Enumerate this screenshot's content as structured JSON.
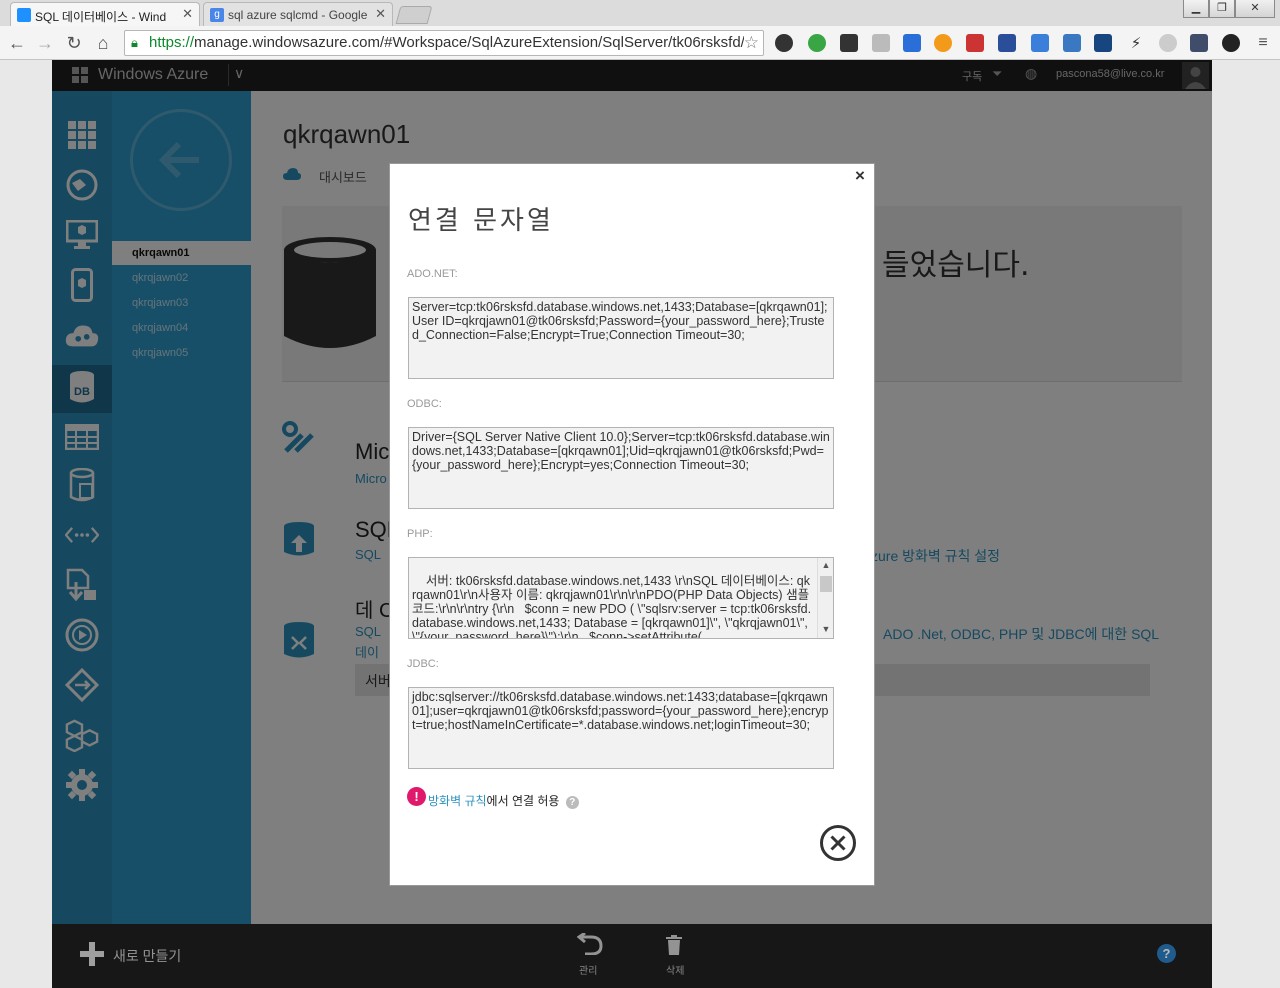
{
  "browser": {
    "tabs": [
      {
        "title": "SQL 데이터베이스 - Wind",
        "active": true
      },
      {
        "title": "sql azure sqlcmd - Google",
        "active": false
      }
    ],
    "url_scheme": "https://",
    "url_rest": "manage.windowsazure.com/#Workspace/SqlAzureExtension/SqlServer/tk06rsksfd/"
  },
  "portal": {
    "brand": "Windows Azure",
    "subscription_label": "구독",
    "user_email": "pascona58@live.co.kr",
    "sub_nav": [
      "qkrqawn01",
      "qkrqjawn02",
      "qkrqjawn03",
      "qkrqjawn04",
      "qkrqjawn05"
    ],
    "db_title": "qkrqawn01",
    "dashboard_tab": "대시보드",
    "banner_text_tail": "들었습니다.",
    "bg": {
      "section1_head": "Mic",
      "section1_link": "Micro",
      "section2_head": "SQL",
      "section2_link": "SQL",
      "section2_tail": "zure 방화벽 규칙 설정",
      "section3_head": "데 C",
      "section3_link": "SQL",
      "section3_tail": "ADO .Net, ODBC, PHP 및 JDBC에 대한 SQL",
      "section3_link2": "데이",
      "server_label": "서버"
    },
    "bottom": {
      "new_label": "새로 만들기",
      "manage_label": "관리",
      "delete_label": "삭제",
      "help": "?"
    }
  },
  "modal": {
    "title": "연결 문자열",
    "close_x": "×",
    "sections": [
      {
        "label": "ADO.NET:",
        "value": "Server=tcp:tk06rsksfd.database.windows.net,1433;Database=[qkrqawn01];User ID=qkrqjawn01@tk06rsksfd;Password={your_password_here};Trusted_Connection=False;Encrypt=True;Connection Timeout=30;"
      },
      {
        "label": "ODBC:",
        "value": "Driver={SQL Server Native Client 10.0};Server=tcp:tk06rsksfd.database.windows.net,1433;Database=[qkrqawn01];Uid=qkrqjawn01@tk06rsksfd;Pwd={your_password_here};Encrypt=yes;Connection Timeout=30;"
      },
      {
        "label": "PHP:",
        "value": "서버: tk06rsksfd.database.windows.net,1433 \\r\\nSQL 데이터베이스: qkrqawn01\\r\\n사용자 이름: qkrqjawn01\\r\\n\\r\\nPDO(PHP Data Objects) 샘플 코드:\\r\\n\\r\\ntry {\\r\\n   $conn = new PDO ( \\\"sqlsrv:server = tcp:tk06rsksfd.database.windows.net,1433; Database = [qkrqawn01]\\\", \\\"qkrqjawn01\\\", \\\"{your_password_here}\\\");\\r\\n   $conn->setAttribute("
      },
      {
        "label": "JDBC:",
        "value": "jdbc:sqlserver://tk06rsksfd.database.windows.net:1433;database=[qkrqawn01];user=qkrqjawn01@tk06rsksfd;password={your_password_here};encrypt=true;hostNameInCertificate=*.database.windows.net;loginTimeout=30;"
      }
    ],
    "firewall_link": "방화벽 규칙",
    "firewall_text": "에서 연결 허용"
  }
}
